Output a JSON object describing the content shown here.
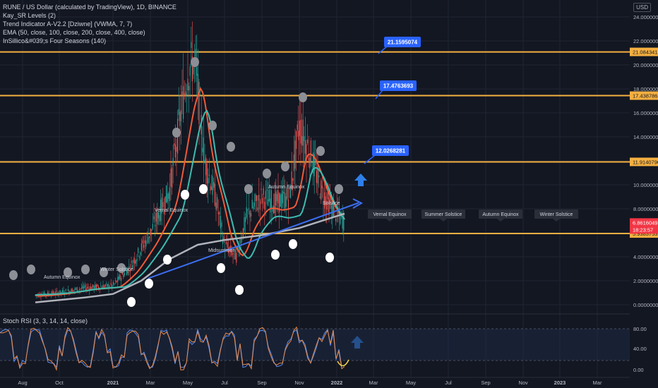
{
  "header": {
    "title": "RUNE / US Dollar (calculated by TradingView), 1D, BINANCE",
    "currency": "USD"
  },
  "indicators": [
    "Kay_SR Levels (2)",
    "Trend Indicator A-V2.2 [Dziwne] (VWMA, 7, 7)",
    "EMA (50, close, 100, close, 200, close, 400, close)",
    "InSillico&#039;s Four Seasons (140)"
  ],
  "rsi_panel": {
    "label": "Stoch RSI (3, 3, 14, 14, close)",
    "ticks": [
      "80.00",
      "40.00",
      "0.00"
    ]
  },
  "price_axis": {
    "ticks": [
      "24.0000000",
      "22.0000000",
      "20.0000000",
      "18.0000000",
      "16.0000000",
      "14.0000000",
      "12.0000000",
      "10.0000000",
      "8.0000000",
      "6.0000000",
      "4.0000000",
      "2.0000000",
      "0.0000000"
    ],
    "level_badges": [
      "21.0843413",
      "17.4387862",
      "11.9140790",
      "5.9383753"
    ],
    "current_price": "6.8616049",
    "countdown": "18:23:57"
  },
  "time_axis": {
    "ticks": [
      "Aug",
      "Oct",
      "2021",
      "Mar",
      "May",
      "Jul",
      "Sep",
      "Nov",
      "2022",
      "Mar",
      "May",
      "Jul",
      "Sep",
      "Nov",
      "2023",
      "Mar"
    ]
  },
  "callouts": [
    "21.1595074",
    "17.4763693",
    "12.0268281"
  ],
  "season_labels_future": [
    "Vernal Equinox",
    "Summer Solstice",
    "Autumn Equinox",
    "Winter Solstice"
  ],
  "season_labels_chart": [
    "Autumn Equinox",
    "Winter Solstice",
    "Vernal Equinox",
    "Midsummer",
    "Autumn Equinox",
    "Solstice"
  ],
  "colors": {
    "background": "#131722",
    "level_line": "#f5b041",
    "callout": "#2962ff",
    "ema_red": "#f05a38",
    "ema_teal": "#3dbcb0",
    "ema_grey": "#b0b3bb",
    "trendline": "#3d6ef0",
    "current_price_badge": "#f23645"
  },
  "chart_data": {
    "type": "line",
    "title": "RUNE / US Dollar (calculated by TradingView), 1D, BINANCE",
    "ylim": [
      0,
      24
    ],
    "x": [
      "Aug",
      "Oct",
      "2021",
      "Mar",
      "May",
      "Jul",
      "Sep",
      "Nov",
      "2022"
    ],
    "series": [
      {
        "values": [
          0.9,
          1.2,
          1.6,
          5.5,
          18.5,
          4.5,
          9.5,
          15.0,
          6.9
        ]
      }
    ],
    "horizontal_levels": [
      21.0843413,
      17.4387862,
      11.914079,
      5.9383753
    ],
    "current_price": 6.8616049,
    "grid": true,
    "legend": "top-left"
  }
}
